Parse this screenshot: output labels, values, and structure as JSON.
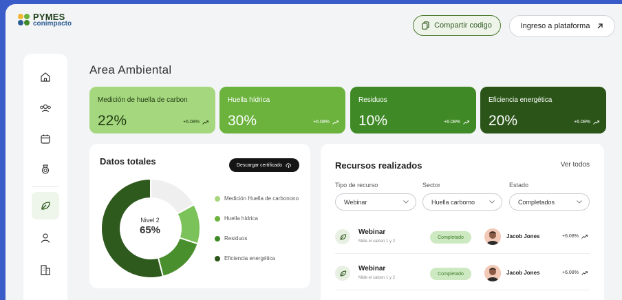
{
  "header": {
    "logo_line1": "PYMES",
    "logo_line2": "conimpacto",
    "share_label": "Compartir codigo",
    "login_label": "Ingreso a plataforma"
  },
  "sidebar": {
    "items": [
      {
        "icon": "home-icon",
        "active": false
      },
      {
        "icon": "users-icon",
        "active": false
      },
      {
        "icon": "calendar-icon",
        "active": false
      },
      {
        "icon": "badge-icon",
        "active": false
      },
      {
        "icon": "leaf-icon",
        "active": true
      },
      {
        "icon": "user-icon",
        "active": false
      },
      {
        "icon": "building-icon",
        "active": false
      }
    ]
  },
  "page": {
    "title": "Area Ambiental"
  },
  "cards": [
    {
      "label": "Medición de huella de carbon",
      "value": "22%",
      "change": "+6.08%",
      "bg": "#a5d77e",
      "fg": "#1f3a12"
    },
    {
      "label": "Huella hídrica",
      "value": "30%",
      "change": "+6.08%",
      "bg": "#6bb33d",
      "fg": "#ffffff"
    },
    {
      "label": "Residuos",
      "value": "10%",
      "change": "+6.08%",
      "bg": "#3f8a26",
      "fg": "#ffffff"
    },
    {
      "label": "Eficiencia energética",
      "value": "20%",
      "change": "+6.08%",
      "bg": "#2b5518",
      "fg": "#ffffff"
    }
  ],
  "datos": {
    "title": "Datos totales",
    "cert_button": "Descargar certificado",
    "center_label": "Nivel 2",
    "center_value": "65%",
    "segments": [
      {
        "color": "#efefef",
        "fraction": 0.17
      },
      {
        "color": "#7cc25a",
        "fraction": 0.13
      },
      {
        "color": "#4a8f2d",
        "fraction": 0.16
      },
      {
        "color": "#2f5a1d",
        "fraction": 0.54
      }
    ],
    "legend": [
      {
        "label": "Medición Huella de carbonono",
        "color": "#a5d77e"
      },
      {
        "label": "Huella hídrica",
        "color": "#6bb33d"
      },
      {
        "label": "Residuos",
        "color": "#3f8a26"
      },
      {
        "label": "Eficiencia energética",
        "color": "#2b5518"
      }
    ]
  },
  "recursos": {
    "title": "Recursos realizados",
    "see_all": "Ver todos",
    "filters": [
      {
        "label": "Tipo de recurso",
        "value": "Webinar"
      },
      {
        "label": "Sector",
        "value": "Huella carbomo"
      },
      {
        "label": "Estado",
        "value": "Completados"
      }
    ],
    "rows": [
      {
        "title": "Webinar",
        "subtitle": "Mide el calcen 1 y 2",
        "status": "Completado",
        "name": "Jacob Jones",
        "change": "+6.08%"
      },
      {
        "title": "Webinar",
        "subtitle": "Mide el calcen 1 y 2",
        "status": "Completado",
        "name": "Jacob Jones",
        "change": "+6.08%"
      }
    ]
  }
}
